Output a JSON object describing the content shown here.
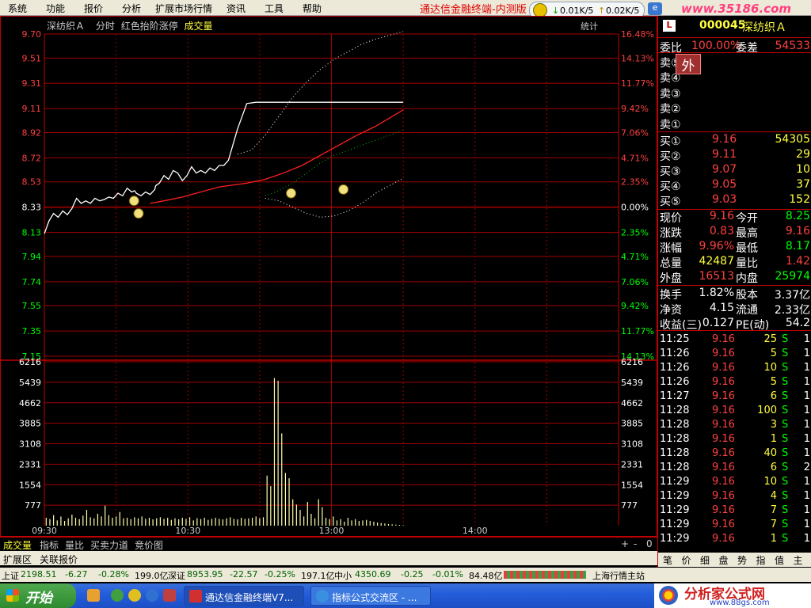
{
  "menubar": {
    "items": [
      "系统",
      "功能",
      "报价",
      "分析",
      "扩展市场行情",
      "资讯",
      "工具",
      "帮助"
    ],
    "title": "通达信金融终端-内测版",
    "net_down": "0.01K/5",
    "net_up": "0.02K/5",
    "watermark": "www.35186.com"
  },
  "chart_header": {
    "stock": "深纺织Ａ",
    "mode": "分时",
    "legend": "红色抬阶涨停",
    "volume": "成交量",
    "stats": "统计"
  },
  "chart_data": [
    {
      "type": "line",
      "x_ticks": [
        "09:30",
        "10:30",
        "13:00",
        "14:00"
      ],
      "price_ticks": [
        9.7,
        9.51,
        9.31,
        9.11,
        8.92,
        8.72,
        8.53,
        8.33,
        8.13,
        7.94,
        7.74,
        7.55,
        7.35,
        7.15
      ],
      "pct_ticks": [
        "16.48%",
        "14.13%",
        "11.77%",
        "9.42%",
        "7.06%",
        "4.71%",
        "2.35%",
        "0.00%",
        "2.35%",
        "4.71%",
        "7.06%",
        "9.42%",
        "11.77%",
        "14.13%"
      ],
      "ylim": [
        7.15,
        9.7
      ],
      "prev_close": 8.33,
      "series": [
        {
          "name": "price",
          "color": "#ffffff",
          "x": [
            0,
            5,
            10,
            15,
            20,
            25,
            30,
            35,
            40,
            45,
            50,
            55,
            60,
            65,
            70,
            75,
            80,
            85,
            90,
            95,
            98,
            100,
            105,
            110,
            115,
            120,
            121,
            125,
            130,
            135,
            140,
            145,
            150,
            155,
            160,
            165,
            170,
            175,
            180,
            185,
            190,
            195,
            200,
            210,
            220,
            230,
            240,
            250,
            260,
            270,
            280,
            290,
            300,
            310,
            320,
            330,
            340,
            350,
            360,
            370,
            380,
            390
          ],
          "y": [
            8.12,
            8.22,
            8.28,
            8.25,
            8.3,
            8.27,
            8.32,
            8.4,
            8.36,
            8.38,
            8.36,
            8.4,
            8.38,
            8.39,
            8.41,
            8.4,
            8.44,
            8.42,
            8.48,
            8.45,
            8.46,
            8.44,
            8.42,
            8.45,
            8.43,
            8.47,
            8.5,
            8.52,
            8.58,
            8.55,
            8.62,
            8.6,
            8.54,
            8.58,
            8.65,
            8.6,
            8.62,
            8.6,
            8.64,
            8.62,
            8.66,
            8.66,
            8.7,
            8.95,
            9.15,
            9.16,
            9.16,
            9.16,
            9.16,
            9.16,
            9.16,
            9.16,
            9.16,
            9.16,
            9.16,
            9.16,
            9.16,
            9.16,
            9.16,
            9.16,
            9.16,
            9.16
          ]
        },
        {
          "name": "avg",
          "color": "#ff2020",
          "x": [
            115,
            130,
            150,
            170,
            190,
            200,
            220,
            240,
            260,
            280,
            300,
            320,
            340,
            360,
            390
          ],
          "y": [
            8.36,
            8.38,
            8.41,
            8.45,
            8.49,
            8.5,
            8.52,
            8.55,
            8.6,
            8.66,
            8.74,
            8.82,
            8.9,
            8.97,
            9.1
          ]
        },
        {
          "name": "upper",
          "color": "#ffffff",
          "x": [
            210,
            225,
            240,
            255,
            270,
            285,
            300,
            315,
            330,
            345,
            360,
            375,
            390
          ],
          "y": [
            8.75,
            8.78,
            8.9,
            9.05,
            9.2,
            9.32,
            9.42,
            9.5,
            9.56,
            9.62,
            9.66,
            9.69,
            9.72
          ]
        },
        {
          "name": "mid",
          "color": "#00c000",
          "x": [
            240,
            255,
            270,
            285,
            300,
            315,
            330,
            345,
            360,
            375,
            390
          ],
          "y": [
            8.42,
            8.46,
            8.52,
            8.6,
            8.68,
            8.74,
            8.78,
            8.82,
            8.86,
            8.9,
            8.94
          ]
        },
        {
          "name": "lower",
          "color": "#ffffff",
          "x": [
            240,
            255,
            270,
            285,
            300,
            315,
            330,
            345,
            360,
            375,
            390
          ],
          "y": [
            8.4,
            8.38,
            8.33,
            8.28,
            8.25,
            8.26,
            8.3,
            8.36,
            8.44,
            8.5,
            8.56
          ]
        }
      ],
      "markers": [
        {
          "x": 60,
          "price": 8.38
        },
        {
          "x": 63,
          "price": 8.28
        },
        {
          "x": 165,
          "price": 8.44
        },
        {
          "x": 200,
          "price": 8.47
        }
      ]
    },
    {
      "type": "bar",
      "title": "成交量",
      "y_ticks": [
        6216,
        5439,
        4662,
        3885,
        3108,
        2331,
        1554,
        777
      ],
      "ylim": [
        0,
        6216
      ],
      "series": [
        {
          "name": "volume",
          "color": "#ffffaa",
          "x": [
            2,
            6,
            10,
            14,
            18,
            22,
            26,
            30,
            34,
            38,
            42,
            46,
            50,
            54,
            58,
            62,
            66,
            70,
            74,
            78,
            82,
            86,
            90,
            94,
            98,
            102,
            106,
            110,
            114,
            118,
            122,
            126,
            130,
            134,
            138,
            142,
            146,
            150,
            154,
            158,
            162,
            166,
            170,
            174,
            178,
            182,
            186,
            190,
            194,
            198,
            202,
            206,
            210,
            214,
            218,
            222,
            226,
            230,
            234,
            238,
            242,
            246,
            250,
            254,
            258,
            262,
            266,
            270,
            274,
            278,
            282,
            286,
            290,
            294,
            298,
            302,
            306,
            310,
            314,
            318,
            322,
            326,
            330,
            334,
            338,
            342,
            346,
            350,
            354,
            358,
            362,
            366,
            370,
            374,
            378,
            382,
            386,
            390
          ],
          "values": [
            300,
            250,
            400,
            200,
            350,
            180,
            280,
            420,
            300,
            250,
            380,
            600,
            320,
            280,
            450,
            350,
            760,
            400,
            300,
            350,
            520,
            280,
            300,
            250,
            320,
            280,
            350,
            260,
            300,
            240,
            280,
            320,
            260,
            300,
            220,
            280,
            240,
            300,
            260,
            320,
            200,
            280,
            250,
            300,
            220,
            260,
            300,
            260,
            240,
            280,
            320,
            260,
            240,
            300,
            260,
            280,
            300,
            350,
            280,
            320,
            1900,
            1500,
            5600,
            5500,
            3500,
            2000,
            1800,
            1000,
            800,
            600,
            350,
            900,
            450,
            280,
            1000,
            700,
            300,
            250,
            350,
            200,
            250,
            150,
            300,
            200,
            250,
            180,
            200,
            220,
            180,
            150,
            120,
            100,
            80,
            60,
            50,
            40,
            30,
            20
          ]
        }
      ]
    }
  ],
  "bottom_tabs": [
    "成交量",
    "指标",
    "量比",
    "买卖力道",
    "竞价图"
  ],
  "bottom_right": [
    "+",
    "-",
    "0"
  ],
  "ext_tabs": [
    "扩展区",
    "关联报价"
  ],
  "panel": {
    "badge": "L",
    "code": "000045",
    "name": "深纺织Ａ",
    "weibi_label": "委比",
    "weibi": "100.00%",
    "weicha_label": "委差",
    "weicha": "54533",
    "sell": [
      "卖⑤",
      "卖④",
      "卖③",
      "卖②",
      "卖①"
    ],
    "sell_tag": "外",
    "buy": [
      {
        "label": "买①",
        "price": "9.16",
        "vol": "54305"
      },
      {
        "label": "买②",
        "price": "9.11",
        "vol": "29"
      },
      {
        "label": "买③",
        "price": "9.07",
        "vol": "10"
      },
      {
        "label": "买④",
        "price": "9.05",
        "vol": "37"
      },
      {
        "label": "买⑤",
        "price": "9.03",
        "vol": "152"
      }
    ],
    "stats1": [
      {
        "l1": "现价",
        "v1": "9.16",
        "l2": "今开",
        "v2": "8.25",
        "c1": "#ff4040",
        "c2": "#00ff00"
      },
      {
        "l1": "涨跌",
        "v1": "0.83",
        "l2": "最高",
        "v2": "9.16",
        "c1": "#ff4040",
        "c2": "#ff4040"
      },
      {
        "l1": "涨幅",
        "v1": "9.96%",
        "l2": "最低",
        "v2": "8.17",
        "c1": "#ff4040",
        "c2": "#00ff00"
      },
      {
        "l1": "总量",
        "v1": "42487",
        "l2": "量比",
        "v2": "1.42",
        "c1": "#ffff40",
        "c2": "#ff4040"
      },
      {
        "l1": "外盘",
        "v1": "16513",
        "l2": "内盘",
        "v2": "25974",
        "c1": "#ff4040",
        "c2": "#00ff00"
      }
    ],
    "stats2": [
      {
        "l1": "换手",
        "v1": "1.82%",
        "l2": "股本",
        "v2": "3.37亿"
      },
      {
        "l1": "净资",
        "v1": "4.15",
        "l2": "流通",
        "v2": "2.33亿"
      },
      {
        "l1": "收益(三)",
        "v1": "0.127",
        "l2": "PE(动)",
        "v2": "54.2"
      }
    ],
    "ticks": [
      {
        "t": "11:25",
        "p": "9.16",
        "v": "25",
        "s": "S",
        "n": "1"
      },
      {
        "t": "11:26",
        "p": "9.16",
        "v": "5",
        "s": "S",
        "n": "1"
      },
      {
        "t": "11:26",
        "p": "9.16",
        "v": "10",
        "s": "S",
        "n": "1"
      },
      {
        "t": "11:26",
        "p": "9.16",
        "v": "5",
        "s": "S",
        "n": "1"
      },
      {
        "t": "11:27",
        "p": "9.16",
        "v": "6",
        "s": "S",
        "n": "1"
      },
      {
        "t": "11:28",
        "p": "9.16",
        "v": "100",
        "s": "S",
        "n": "1"
      },
      {
        "t": "11:28",
        "p": "9.16",
        "v": "3",
        "s": "S",
        "n": "1"
      },
      {
        "t": "11:28",
        "p": "9.16",
        "v": "1",
        "s": "S",
        "n": "1"
      },
      {
        "t": "11:28",
        "p": "9.16",
        "v": "40",
        "s": "S",
        "n": "1"
      },
      {
        "t": "11:28",
        "p": "9.16",
        "v": "6",
        "s": "S",
        "n": "2"
      },
      {
        "t": "11:29",
        "p": "9.16",
        "v": "10",
        "s": "S",
        "n": "1"
      },
      {
        "t": "11:29",
        "p": "9.16",
        "v": "4",
        "s": "S",
        "n": "1"
      },
      {
        "t": "11:29",
        "p": "9.16",
        "v": "7",
        "s": "S",
        "n": "1"
      },
      {
        "t": "11:29",
        "p": "9.16",
        "v": "7",
        "s": "S",
        "n": "1"
      },
      {
        "t": "11:29",
        "p": "9.16",
        "v": "1",
        "s": "S",
        "n": "1"
      }
    ],
    "panel_tabs": [
      "笔",
      "价",
      "细",
      "盘",
      "势",
      "指",
      "值",
      "主"
    ]
  },
  "statusbar": {
    "sh_label": "上证",
    "sh_val": "2198.51",
    "sh_chg": "-6.27",
    "sh_pct": "-0.28%",
    "sh_amt": "199.0亿",
    "sz_label": "深证",
    "sz_val": "8953.95",
    "sz_chg": "-22.57",
    "sz_pct": "-0.25%",
    "sz_amt": "197.1亿",
    "zx_label": "中小",
    "zx_val": "4350.69",
    "zx_chg": "-0.25",
    "zx_pct": "-0.01%",
    "zx_amt": "84.48亿",
    "right": "上海行情主站"
  },
  "taskbar": {
    "start": "开始",
    "btn1": "通达信金融终端V7...",
    "btn2": "指标公式交流区 - ...",
    "brand": "分析家公式网",
    "brand_url": "www.88gs.com"
  }
}
